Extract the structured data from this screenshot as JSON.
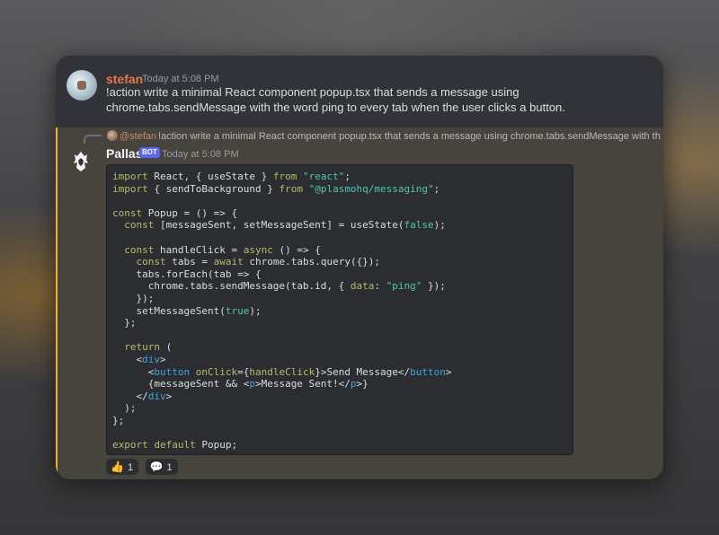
{
  "message_user": {
    "username": "stefan",
    "timestamp": "Today at 5:08 PM",
    "text": "!action write a minimal React component popup.tsx that sends a message using chrome.tabs.sendMessage with the word ping to every tab when the user clicks a button."
  },
  "message_bot": {
    "reply": {
      "mention": "@stefan",
      "text": "!action write a minimal React component popup.tsx that sends a message using chrome.tabs.sendMessage with th"
    },
    "username": "Pallas",
    "badge": "BOT",
    "timestamp": "Today at 5:08 PM",
    "code_lines": [
      "import React, { useState } from \"react\";",
      "import { sendToBackground } from \"@plasmohq/messaging\";",
      "",
      "const Popup = () => {",
      "  const [messageSent, setMessageSent] = useState(false);",
      "",
      "  const handleClick = async () => {",
      "    const tabs = await chrome.tabs.query({});",
      "    tabs.forEach(tab => {",
      "      chrome.tabs.sendMessage(tab.id, { data: \"ping\" });",
      "    });",
      "    setMessageSent(true);",
      "  };",
      "",
      "  return (",
      "    <div>",
      "      <button onClick={handleClick}>Send Message</button>",
      "      {messageSent && <p>Message Sent!</p>}",
      "    </div>",
      "  );",
      "};",
      "",
      "export default Popup;"
    ],
    "reactions": [
      {
        "emoji": "👍",
        "icon": "thumbs-up-icon",
        "count": "1"
      },
      {
        "emoji": "💬",
        "icon": "speech-balloon-icon",
        "count": "1"
      }
    ]
  },
  "colors": {
    "accent": "#f0b232",
    "highlight_bg": "#47443d",
    "user_name": "#e07a4a",
    "bot_badge": "#5865f2"
  }
}
